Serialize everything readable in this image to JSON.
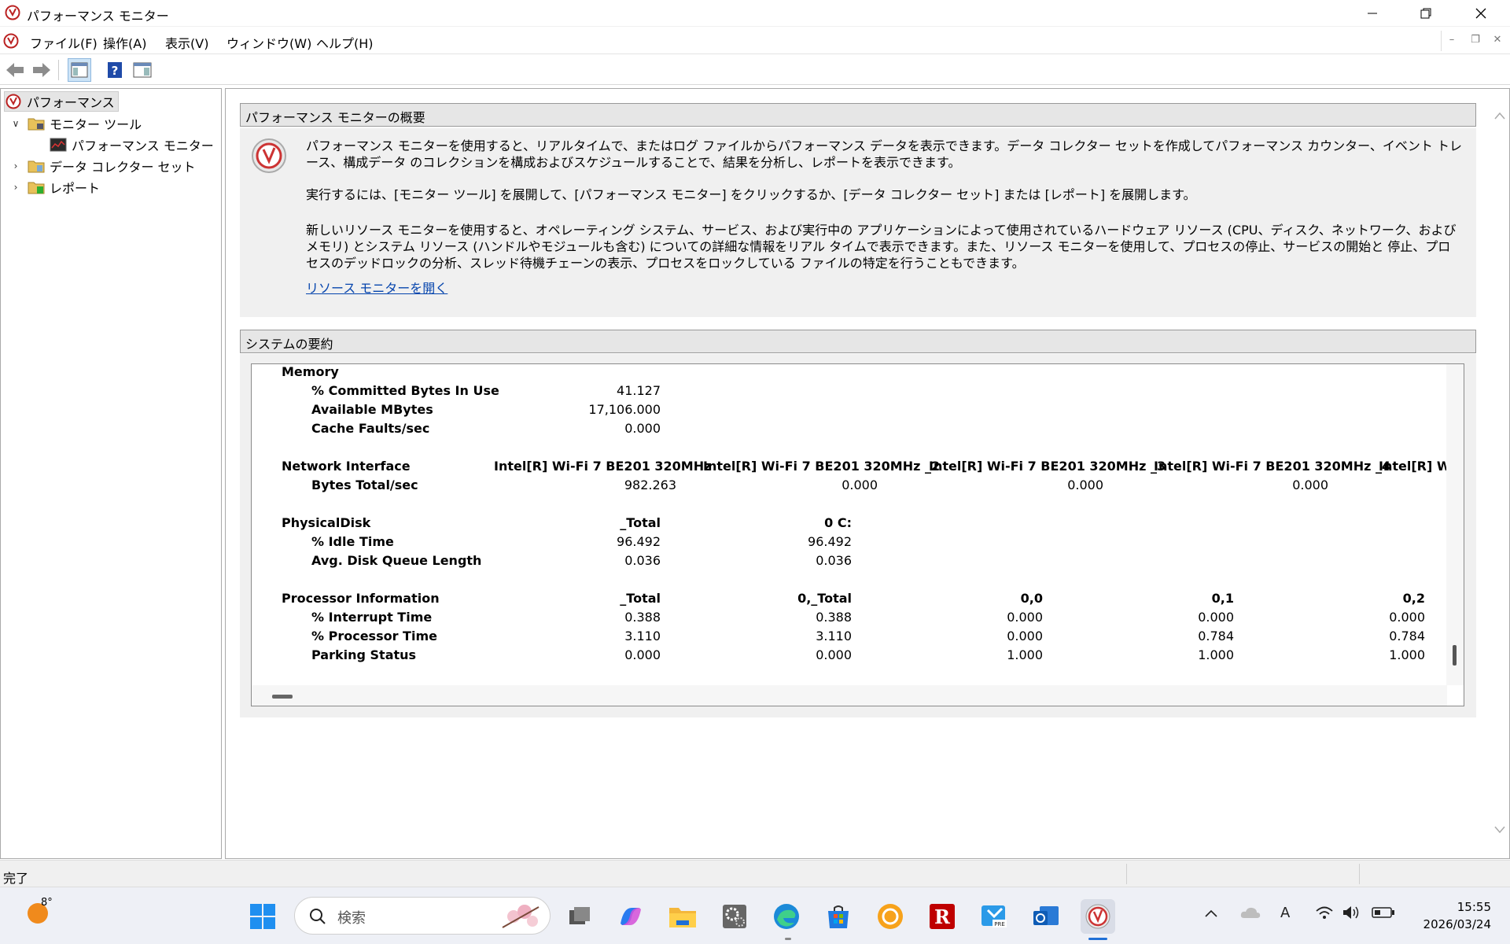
{
  "window": {
    "title": "パフォーマンス モニター"
  },
  "menu": [
    "ファイル(F)",
    "操作(A)",
    "表示(V)",
    "ウィンドウ(W)",
    "ヘルプ(H)"
  ],
  "tree": {
    "root": "パフォーマンス",
    "monitor_tools": "モニター ツール",
    "perf_monitor": "パフォーマンス モニター",
    "data_collector_sets": "データ コレクター セット",
    "reports": "レポート"
  },
  "overview": {
    "heading": "パフォーマンス モニターの概要",
    "para1": "パフォーマンス モニターを使用すると、リアルタイムで、またはログ ファイルからパフォーマンス データを表示できます。データ コレクター セットを作成してパフォーマンス カウンター、イベント トレース、構成データ のコレクションを構成およびスケジュールすることで、結果を分析し、レポートを表示できます。",
    "para2": "実行するには、[モニター ツール] を展開して、[パフォーマンス モニター] をクリックするか、[データ コレクター セット] または [レポート] を展開します。",
    "para3": "新しいリソース モニターを使用すると、オペレーティング システム、サービス、および実行中の アプリケーションによって使用されているハードウェア リソース (CPU、ディスク、ネットワーク、およびメモリ) とシステム リソース (ハンドルやモジュールも含む) についての詳細な情報をリアル タイムで表示できます。また、リソース モニターを使用して、プロセスの停止、サービスの開始と 停止、プロセスのデッドロックの分析、スレッド待機チェーンの表示、プロセスをロックしている ファイルの特定を行うこともできます。",
    "link": "リソース モニターを開く"
  },
  "summary": {
    "heading": "システムの要約",
    "memory": {
      "label": "Memory",
      "rows": [
        {
          "name": "% Committed Bytes In Use",
          "value": "41.127"
        },
        {
          "name": "Available MBytes",
          "value": "17,106.000"
        },
        {
          "name": "Cache Faults/sec",
          "value": "0.000"
        }
      ]
    },
    "network": {
      "label": "Network Interface",
      "instances": [
        "Intel[R] Wi-Fi 7 BE201 320MHz",
        "Intel[R] Wi-Fi 7 BE201 320MHz _2",
        "Intel[R] Wi-Fi 7 BE201 320MHz _3",
        "Intel[R] Wi-Fi 7 BE201 320MHz _4",
        "Intel[R] W"
      ],
      "counter": "Bytes Total/sec",
      "values": [
        "982.263",
        "0.000",
        "0.000",
        "0.000"
      ]
    },
    "disk": {
      "label": "PhysicalDisk",
      "instances": [
        "_Total",
        "0 C:"
      ],
      "rows": [
        {
          "name": "% Idle Time",
          "values": [
            "96.492",
            "96.492"
          ]
        },
        {
          "name": "Avg. Disk Queue Length",
          "values": [
            "0.036",
            "0.036"
          ]
        }
      ]
    },
    "processor": {
      "label": "Processor Information",
      "instances": [
        "_Total",
        "0,_Total",
        "0,0",
        "0,1",
        "0,2"
      ],
      "rows": [
        {
          "name": "% Interrupt Time",
          "values": [
            "0.388",
            "0.388",
            "0.000",
            "0.000",
            "0.000"
          ]
        },
        {
          "name": "% Processor Time",
          "values": [
            "3.110",
            "3.110",
            "0.000",
            "0.784",
            "0.784"
          ]
        },
        {
          "name": "Parking Status",
          "values": [
            "0.000",
            "0.000",
            "1.000",
            "1.000",
            "1.000"
          ]
        }
      ]
    }
  },
  "status": {
    "text": "完了"
  },
  "taskbar": {
    "weather_temp": "8°",
    "search_placeholder": "検索",
    "time": "15:55",
    "date": "2026/03/24",
    "ime": "A"
  }
}
